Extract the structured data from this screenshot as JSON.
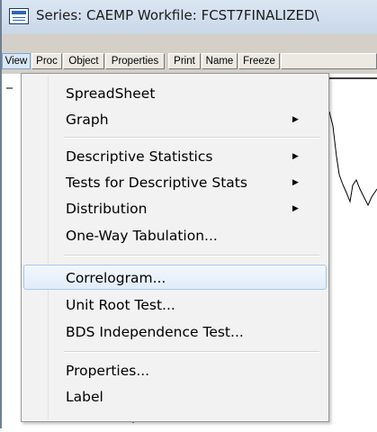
{
  "window": {
    "title": "Series: CAEMP   Workfile: FCST7FINALIZED\\"
  },
  "toolbar": {
    "buttons": [
      "View",
      "Proc",
      "Object",
      "Properties",
      "Print",
      "Name",
      "Freeze",
      ""
    ]
  },
  "menu": {
    "items": [
      {
        "label": "SpreadSheet",
        "submenu": false
      },
      {
        "label": "Graph",
        "submenu": true
      },
      {
        "label": "Descriptive Statistics",
        "submenu": true
      },
      {
        "label": "Tests for Descriptive Stats",
        "submenu": true
      },
      {
        "label": "Distribution",
        "submenu": true
      },
      {
        "label": "One-Way Tabulation...",
        "submenu": false
      },
      {
        "label": "Correlogram...",
        "submenu": false,
        "highlighted": true
      },
      {
        "label": "Unit Root Test...",
        "submenu": false
      },
      {
        "label": "BDS Independence Test...",
        "submenu": false
      },
      {
        "label": "Properties...",
        "submenu": false
      },
      {
        "label": "Label",
        "submenu": false
      }
    ]
  },
  "colors": {
    "highlight_border": "#a8c8ec",
    "menu_background": "#f2f2f2",
    "chart_line": "#000000"
  }
}
